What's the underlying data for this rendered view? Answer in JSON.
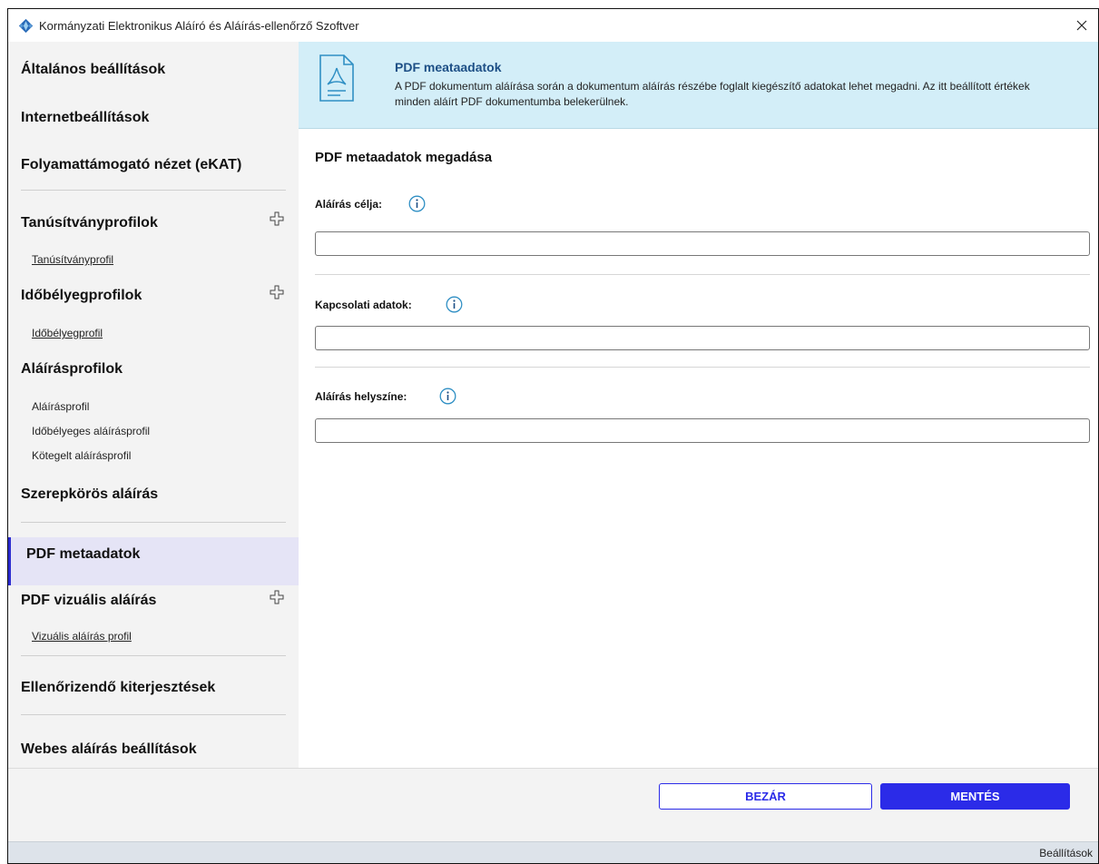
{
  "window": {
    "title": "Kormányzati Elektronikus Aláíró és Aláírás-ellenőrző Szoftver",
    "icon": "app-logo-icon",
    "close_icon": "close-icon"
  },
  "sidebar": {
    "items": [
      {
        "label": "Általános beállítások"
      },
      {
        "label": "Internetbeállítások"
      },
      {
        "label": "Folyamattámogató nézet (eKAT)"
      },
      {
        "label": "Tanúsítványprofilok",
        "add_icon": "plus-icon"
      },
      {
        "label": "Tanúsítványprofil"
      },
      {
        "label": "Időbélyegprofilok",
        "add_icon": "plus-icon"
      },
      {
        "label": "Időbélyegprofil"
      },
      {
        "label": "Aláírásprofilok"
      },
      {
        "label": "Aláírásprofil"
      },
      {
        "label": "Időbélyeges aláírásprofil"
      },
      {
        "label": "Kötegelt aláírásprofil"
      },
      {
        "label": "Szerepkörös aláírás"
      },
      {
        "label": "PDF metaadatok",
        "active": true
      },
      {
        "label": "PDF vizuális aláírás",
        "add_icon": "plus-icon"
      },
      {
        "label": "Vizuális aláírás profil"
      },
      {
        "label": "Ellenőrizendő kiterjesztések"
      },
      {
        "label": "Webes aláírás beállítások"
      }
    ],
    "active_color": "#e5e4f6",
    "accent_color": "#2a2ad0"
  },
  "banner": {
    "icon": "pdf-document-icon",
    "title": "PDF meataadatok",
    "description": "A PDF dokumentum aláírása során a dokumentum aláírás részébe foglalt kiegészítő adatokat lehet megadni. Az itt beállított értékek minden aláírt PDF dokumentumba belekerülnek."
  },
  "main": {
    "section_title": "PDF metaadatok megadása",
    "fields": [
      {
        "label": "Aláírás célja:",
        "value": "",
        "info_icon": "info-icon"
      },
      {
        "label": "Kapcsolati adatok:",
        "value": "",
        "info_icon": "info-icon"
      },
      {
        "label": "Aláírás helyszíne:",
        "value": "",
        "info_icon": "info-icon"
      }
    ]
  },
  "footer": {
    "close_label": "BEZÁR",
    "save_label": "MENTÉS",
    "primary_color": "#2b2be8"
  },
  "statusbar": {
    "text": "Beállítások"
  }
}
